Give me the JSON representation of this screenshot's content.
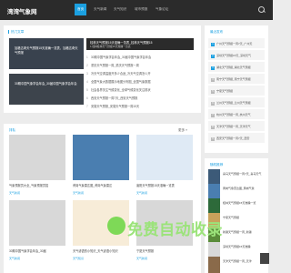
{
  "site": {
    "logo": "湾湾气象网"
  },
  "nav": {
    "links": [
      "首页",
      "天气新闻",
      "天气知识",
      "城市预报",
      "气象论坛"
    ]
  },
  "hot": {
    "title": "热门文章",
    "img1": "加格达奇天气预报15天准确一览表，加格达奇天气预报",
    "img2": "30期中国气象学会年会_30届中国气象学会年会",
    "headline": "桂林天气预报15天准确一览表_桂林天气预报15",
    "headline_sub": "1.桂林桂林天气预报15天准确一览表",
    "list": [
      "30期中国气象学会年会_30届中国气象学会年会",
      "重庆天气预报一周_重庆天气预报一周",
      "冷天气空调温度开多少合适_冷天气空调怎么开",
      "全国气象大数据展示地图分布图_全国气象数据",
      "社会各界关注气候变化_全球气候变化关注现状",
      "西安天气预报一周7天_西安天气预报",
      "安徽天气预报_安徽天气预报一周15天"
    ]
  },
  "latest": {
    "title": "排队",
    "more": "更多 »",
    "cards": [
      {
        "title": "气象预报员大全_气象预报员招",
        "tag": "天气新闻"
      },
      {
        "title": "黄岗气象雷达图_黄岗气象雷达",
        "tag": "天气新闻"
      },
      {
        "title": "襄阳天气预报15天准确一览表",
        "tag": "天气新闻"
      },
      {
        "title": "30期中国气象学会年会_30届",
        "tag": "天气新闻"
      },
      {
        "title": "天气谚语的小知识_天气谚语小知识",
        "tag": "天气知识"
      },
      {
        "title": "宁夏天气预报",
        "tag": "天气新闻"
      }
    ]
  },
  "side1": {
    "title": "最近发布",
    "items": [
      "广州天气预报一周7天_广州天",
      "深圳天气预报15天_深圳天气",
      "湖北天气预报_湖北天气预报",
      "南宁天气预报_南宁天气预报",
      "宁夏天气预报",
      "兰州天气预报_兰州天气预报",
      "杭州天气预报一周_杭州天气",
      "天津天气预报一周_天津天气",
      "西安天气预报一周7天_西安"
    ]
  },
  "side2": {
    "title": "随机推荐",
    "items": [
      "喜马天气预报一周7天_喜马天气",
      "黄岗气象雷达图_黄岗气象",
      "桂林天气预报15天准确一览",
      "宁夏天气预报",
      "新疆天气预报一周_新疆",
      "深圳天气预报15天准确",
      "天津天气预报一周_天津"
    ]
  },
  "watermark": {
    "text": "免费自动收录"
  },
  "colors": {
    "accent": "#1ba0e1",
    "nav_bg": "#2b2b2b",
    "page_bg": "#ececec"
  }
}
